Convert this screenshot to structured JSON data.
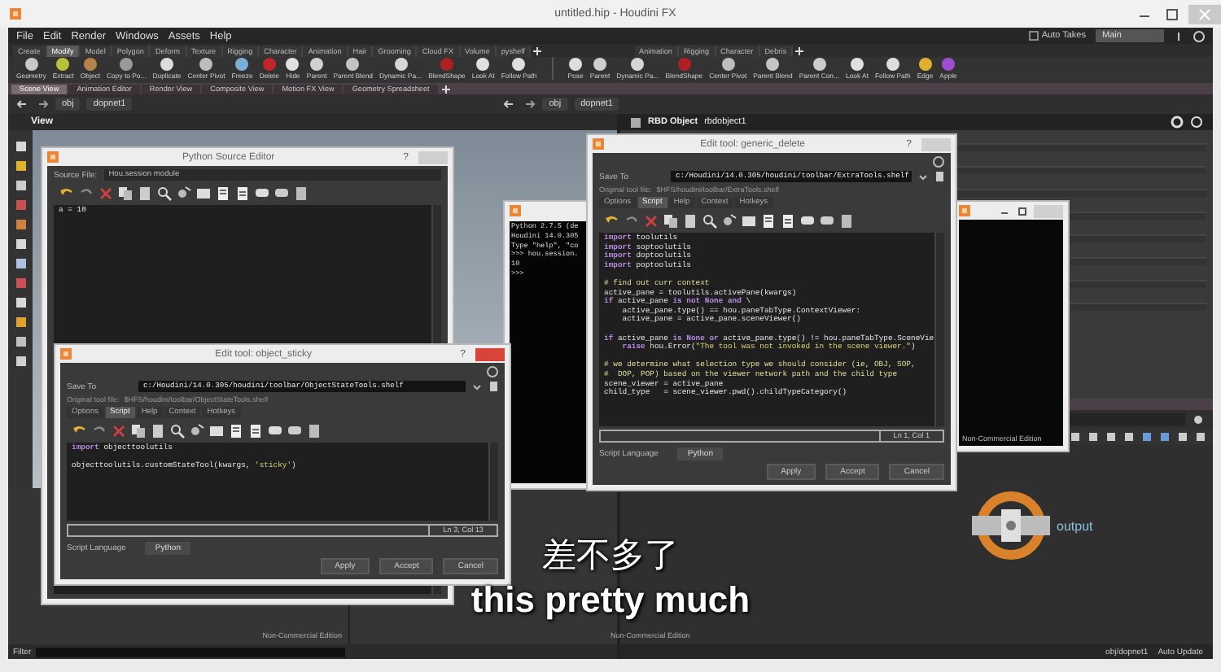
{
  "window": {
    "title": "untitled.hip - Houdini FX"
  },
  "menu": [
    "File",
    "Edit",
    "Render",
    "Windows",
    "Assets",
    "Help"
  ],
  "auto_takes": {
    "label": "Auto Takes",
    "checked": false
  },
  "desktop": "Main",
  "shelf_tabs": [
    {
      "label": "Create",
      "selected": false
    },
    {
      "label": "Modify",
      "selected": true
    },
    {
      "label": "Model",
      "selected": false
    },
    {
      "label": "Polygon",
      "selected": false
    },
    {
      "label": "Deform",
      "selected": false
    },
    {
      "label": "Texture",
      "selected": false
    },
    {
      "label": "Rigging",
      "selected": false
    },
    {
      "label": "Character",
      "selected": false
    },
    {
      "label": "Animation",
      "selected": false
    },
    {
      "label": "Hair",
      "selected": false
    },
    {
      "label": "Grooming",
      "selected": false
    },
    {
      "label": "Cloud FX",
      "selected": false
    },
    {
      "label": "Volume",
      "selected": false
    },
    {
      "label": "pyshelf",
      "selected": false
    }
  ],
  "shelf_tabs_right": [
    {
      "label": "Animation",
      "selected": false
    },
    {
      "label": "Rigging",
      "selected": false
    },
    {
      "label": "Character",
      "selected": false
    },
    {
      "label": "Debris",
      "selected": false
    }
  ],
  "shelf_tools": [
    {
      "label": "Geometry",
      "color": "#c8c8c8"
    },
    {
      "label": "Extract",
      "color": "#b5c23a"
    },
    {
      "label": "Object",
      "color": "#b5834a"
    },
    {
      "label": "Copy to Po...",
      "color": "#9a9a9a"
    },
    {
      "label": "Duplicate",
      "color": "#dcdcdc"
    },
    {
      "label": "Center Pivot",
      "color": "#bdbdbd"
    },
    {
      "label": "Freeze",
      "color": "#7ab0d8"
    },
    {
      "label": "Delete",
      "color": "#c0262a"
    },
    {
      "label": "Hide",
      "color": "#e0e0e0"
    },
    {
      "label": "Parent",
      "color": "#d0d0d0"
    },
    {
      "label": "Parent Blend",
      "color": "#c4c4c4"
    },
    {
      "label": "Dynamic Pa...",
      "color": "#d6d6d6"
    },
    {
      "label": "BlendShape",
      "color": "#b02020"
    },
    {
      "label": "Look At",
      "color": "#e0e0e0"
    },
    {
      "label": "Follow Path",
      "color": "#dedede"
    }
  ],
  "shelf_tools_right": [
    {
      "label": "Pose",
      "color": "#dddddd"
    },
    {
      "label": "Parent",
      "color": "#cfcfcf"
    },
    {
      "label": "Dynamic Pa...",
      "color": "#d6d6d6"
    },
    {
      "label": "BlendShape",
      "color": "#b02020"
    },
    {
      "label": "Center Pivot",
      "color": "#bdbdbd"
    },
    {
      "label": "Parent Blend",
      "color": "#c4c4c4"
    },
    {
      "label": "Parent Con...",
      "color": "#cccccc"
    },
    {
      "label": "Look At",
      "color": "#e0e0e0"
    },
    {
      "label": "Follow Path",
      "color": "#dedede"
    },
    {
      "label": "Edge",
      "color": "#e0b030"
    },
    {
      "label": "Apple",
      "color": "#9b4fd0"
    }
  ],
  "pane_tabs": [
    {
      "label": "Scene View",
      "selected": true
    },
    {
      "label": "Animation Editor",
      "selected": false
    },
    {
      "label": "Render View",
      "selected": false
    },
    {
      "label": "Composite View",
      "selected": false
    },
    {
      "label": "Motion FX View",
      "selected": false
    },
    {
      "label": "Geometry Spreadsheet",
      "selected": false
    }
  ],
  "path": [
    "obj",
    "dopnet1"
  ],
  "network_path": [
    "obj",
    "dopnet1"
  ],
  "viewport": {
    "label": "View"
  },
  "parameters": {
    "node_type": "RBD Object",
    "node_name": "rbdobject1"
  },
  "tree_pane": {
    "edition": "Non-Commercial Edition"
  },
  "filter": {
    "label": "Filter"
  },
  "network": {
    "node": {
      "name": "output"
    },
    "edition": "Non-Commercial Edition"
  },
  "status_bar": {
    "path": "obj/dopnet1",
    "update_mode": "Auto Update"
  },
  "python_source_editor": {
    "title": "Python Source Editor",
    "help": "?",
    "source_file_label": "Source File:",
    "source_file": "Hou.session module",
    "code": [
      [
        [
          {
            "kind": "plain",
            "text": "a = 10"
          }
        ]
      ]
    ]
  },
  "python_shell": {
    "lines": [
      "Python 2.7.5 (de",
      "Houdini 14.0.305",
      "Type \"help\", \"co",
      ">>> hou.session.",
      "10",
      ">>>"
    ]
  },
  "viewer_window": {
    "edition": "Non-Commercial Edition"
  },
  "tool_editors": [
    {
      "title": "Edit tool: object_sticky",
      "help": "?",
      "active": true,
      "save_to_label": "Save To",
      "save_to": "c:/Houdini/14.0.305/houdini/toolbar/ObjectStateTools.shelf",
      "original_label": "Original tool file:",
      "original": "$HFS/houdini/toolbar/ObjectStateTools.shelf",
      "tabs": [
        {
          "label": "Options",
          "selected": false
        },
        {
          "label": "Script",
          "selected": true
        },
        {
          "label": "Help",
          "selected": false
        },
        {
          "label": "Context",
          "selected": false
        },
        {
          "label": "Hotkeys",
          "selected": false
        }
      ],
      "code": [
        [
          [
            {
              "kind": "keyword",
              "text": "import"
            },
            {
              "kind": "plain",
              "text": " objecttoolutils"
            }
          ]
        ],
        [
          [
            {
              "kind": "plain",
              "text": "objecttoolutils.customStateTool(kwargs, "
            },
            {
              "kind": "string",
              "text": "'sticky'"
            },
            {
              "kind": "plain",
              "text": ")"
            }
          ]
        ]
      ],
      "cursor": "Ln 3, Col 13",
      "language_label": "Script Language",
      "language": "Python",
      "buttons": [
        "Apply",
        "Accept",
        "Cancel"
      ]
    },
    {
      "title": "Edit tool: generic_delete",
      "help": "?",
      "active": false,
      "save_to_label": "Save To",
      "save_to": "c:/Houdini/14.0.305/houdini/toolbar/ExtraTools.shelf",
      "original_label": "Original tool file:",
      "original": "$HFS/houdini/toolbar/ExtraTools.shelf",
      "tabs": [
        {
          "label": "Options",
          "selected": false
        },
        {
          "label": "Script",
          "selected": true
        },
        {
          "label": "Help",
          "selected": false
        },
        {
          "label": "Context",
          "selected": false
        },
        {
          "label": "Hotkeys",
          "selected": false
        }
      ],
      "code": [
        [
          [
            {
              "kind": "keyword",
              "text": "import"
            },
            {
              "kind": "plain",
              "text": " toolutils"
            }
          ],
          [
            {
              "kind": "keyword",
              "text": "import"
            },
            {
              "kind": "plain",
              "text": " soptoolutils"
            }
          ],
          [
            {
              "kind": "keyword",
              "text": "import"
            },
            {
              "kind": "plain",
              "text": " doptoolutils"
            }
          ],
          [
            {
              "kind": "keyword",
              "text": "import"
            },
            {
              "kind": "plain",
              "text": " poptoolutils"
            }
          ]
        ],
        [
          [
            {
              "kind": "comment",
              "text": "# find out curr context"
            }
          ],
          [
            {
              "kind": "plain",
              "text": "active_pane = toolutils.activePane(kwargs)"
            }
          ],
          [
            {
              "kind": "keyword",
              "text": "if"
            },
            {
              "kind": "plain",
              "text": " active_pane "
            },
            {
              "kind": "keyword",
              "text": "is not None and"
            },
            {
              "kind": "plain",
              "text": " \\"
            }
          ],
          [
            {
              "kind": "plain",
              "text": "    active_pane.type() == hou.paneTabType.ContextViewer:"
            }
          ],
          [
            {
              "kind": "plain",
              "text": "    active_pane = active_pane.sceneViewer()"
            }
          ]
        ],
        [
          [
            {
              "kind": "keyword",
              "text": "if"
            },
            {
              "kind": "plain",
              "text": " active_pane "
            },
            {
              "kind": "keyword",
              "text": "is None or"
            },
            {
              "kind": "plain",
              "text": " active_pane.type() != hou.paneTabType.SceneVie"
            }
          ],
          [
            {
              "kind": "keyword",
              "text": "    raise"
            },
            {
              "kind": "plain",
              "text": " hou.Error("
            },
            {
              "kind": "string",
              "text": "\"The tool was not invoked in the scene viewer.\""
            },
            {
              "kind": "plain",
              "text": ")"
            }
          ]
        ],
        [
          [
            {
              "kind": "comment",
              "text": "# we determine what selection type we should consider (ie, OBJ, SOP,"
            }
          ],
          [
            {
              "kind": "comment",
              "text": "#  DOP, POP) based on the viewer network path and the child type"
            }
          ],
          [
            {
              "kind": "plain",
              "text": "scene_viewer = active_pane"
            }
          ],
          [
            {
              "kind": "plain",
              "text": "child_type   = scene_viewer.pwd().childTypeCategory()"
            }
          ]
        ]
      ],
      "cursor": "Ln 1, Col 1",
      "language_label": "Script Language",
      "language": "Python",
      "buttons": [
        "Apply",
        "Accept",
        "Cancel"
      ]
    }
  ],
  "subtitle": {
    "chinese": "差不多了",
    "english": "this pretty much"
  }
}
